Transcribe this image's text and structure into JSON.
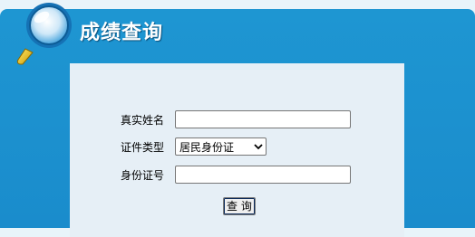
{
  "header": {
    "title": "成绩查询"
  },
  "form": {
    "name": {
      "label": "真实姓名",
      "value": ""
    },
    "id_type": {
      "label": "证件类型",
      "selected": "居民身份证"
    },
    "id_number": {
      "label": "身份证号",
      "value": ""
    },
    "submit_label": "查 询"
  },
  "colors": {
    "panel": "#1e96d2",
    "inner": "#e6eff6"
  },
  "icons": {
    "header": "magnifier-icon",
    "select": "chevron-down-icon"
  }
}
